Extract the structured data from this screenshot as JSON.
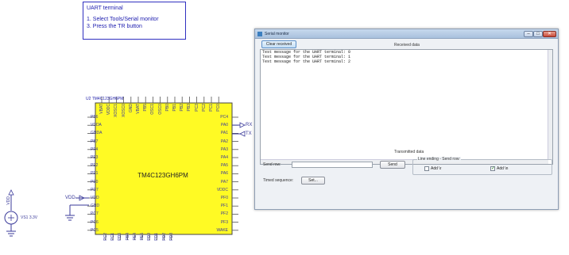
{
  "note": {
    "title": "UART terminal",
    "step1": "1. Select Tools/Serial monitor",
    "step2": "3. Press the TR button"
  },
  "chip": {
    "ref": "U2 TM4C123GH6PM",
    "name": "TM4C123GH6PM",
    "left_pins": [
      "PB6",
      "VDDA",
      "GNDA",
      "PB7",
      "PF4",
      "PE3",
      "PE2",
      "PE1",
      "PE0",
      "PD7",
      "VDD",
      "GND",
      "PC7",
      "PC6",
      "PC5"
    ],
    "right_pins": [
      "PC4",
      "PA0",
      "PA1",
      "PA2",
      "PA3",
      "PA4",
      "PA5",
      "PA6",
      "PA7",
      "VDDC",
      "PF0",
      "PF1",
      "PF2",
      "PF3",
      "WAKE"
    ],
    "top_pins": [
      "VBAT",
      "VDDC",
      "XOSC1",
      "XOSC0",
      "GND",
      "VBAT",
      "PB5",
      "OSC1",
      "OSC0",
      "PB0",
      "PB1",
      "PB2",
      "PB3",
      "PC3",
      "PC2",
      "PC1",
      "PC0"
    ],
    "bottom_pins": [
      "PC2",
      "PC1",
      "PD6",
      "PB4",
      "PE4",
      "PE5",
      "PD0",
      "PD1",
      "PD2",
      "PD3"
    ]
  },
  "signals": {
    "rx": "RX",
    "tx": "TX",
    "vdd": "VDD"
  },
  "vsource": {
    "label": "VS1 3.3V",
    "vdd": "VDD"
  },
  "serial_monitor": {
    "title": "Serial monitor",
    "controls": {
      "minimize": "–",
      "maximize": "□",
      "close": "✕"
    },
    "clear_button": "Clear received",
    "received_label": "Received data",
    "received_lines": [
      "Test message for the UART terminal: 0",
      "Test message for the UART terminal: 1",
      "Test message for the UART terminal: 2"
    ],
    "transmitted_label": "Transmitted data",
    "send_label": "Send row:",
    "send_value": "",
    "send_button": "Send",
    "line_ending_label": "Line ending - Send row:",
    "add_r_label": "Add \\r",
    "add_r_checked": false,
    "add_n_label": "Add \\n",
    "add_n_checked": true,
    "check_mark": "✓",
    "timed_label": "Timed sequence:",
    "set_button": "Set..."
  }
}
